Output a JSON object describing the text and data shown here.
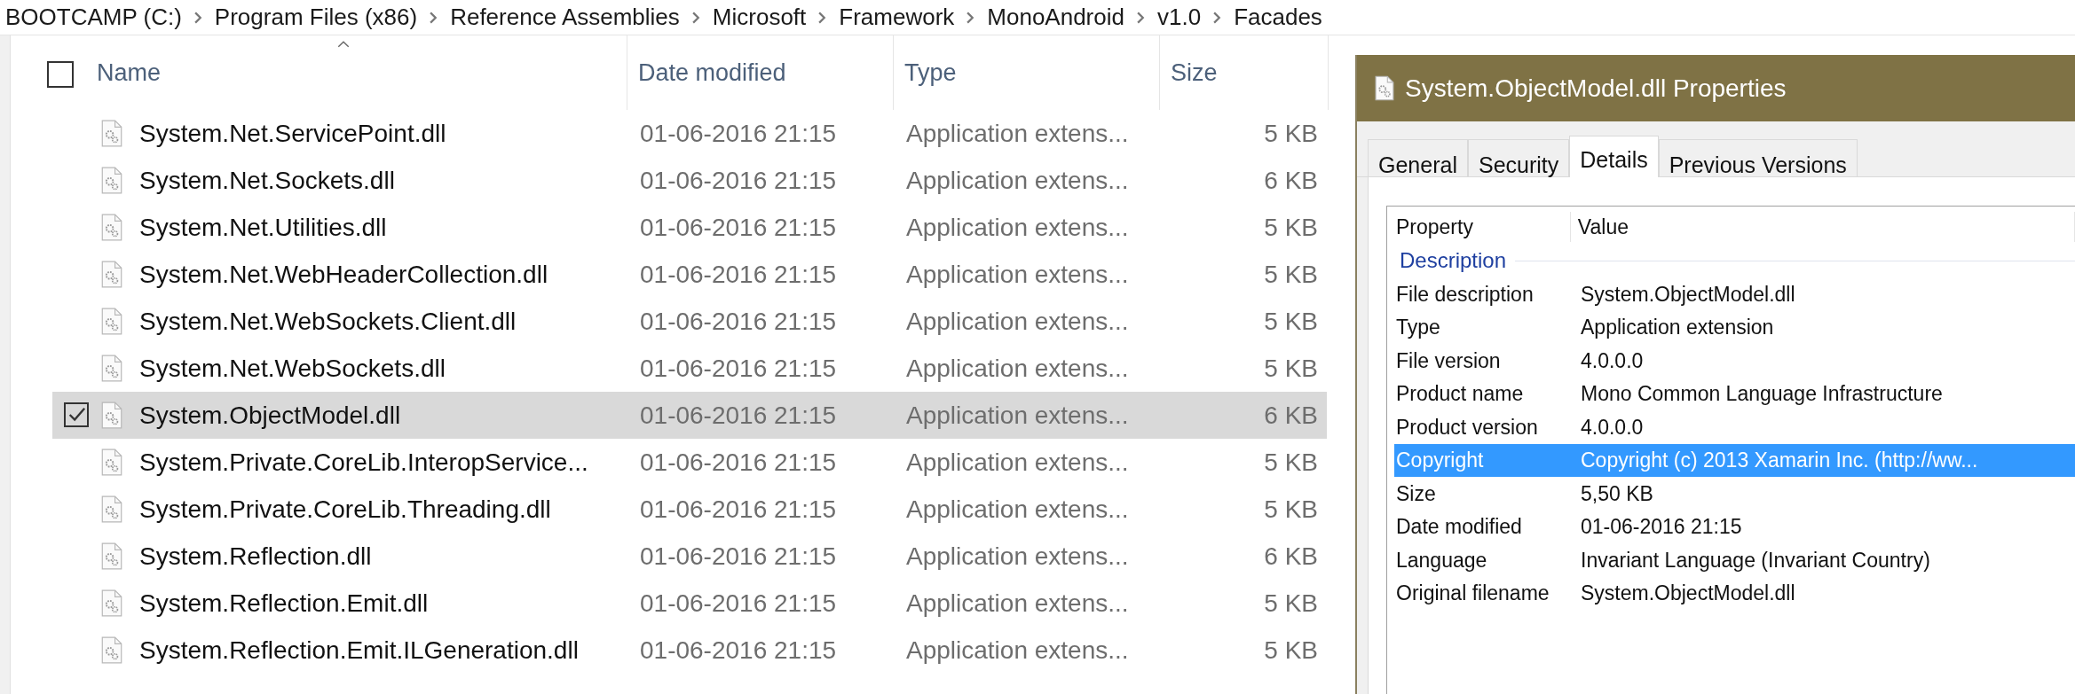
{
  "breadcrumb": [
    "BOOTCAMP (C:)",
    "Program Files (x86)",
    "Reference Assemblies",
    "Microsoft",
    "Framework",
    "MonoAndroid",
    "v1.0",
    "Facades"
  ],
  "file_list": {
    "select_all": {
      "checked": false
    },
    "columns": [
      {
        "label": "Name",
        "sorted": true
      },
      {
        "label": "Date modified",
        "sorted": false
      },
      {
        "label": "Type",
        "sorted": false
      },
      {
        "label": "Size",
        "sorted": false
      }
    ],
    "rows": [
      {
        "name": "System.Net.ServicePoint.dll",
        "date": "01-06-2016 21:15",
        "type": "Application extens...",
        "size": "5 KB",
        "selected": false
      },
      {
        "name": "System.Net.Sockets.dll",
        "date": "01-06-2016 21:15",
        "type": "Application extens...",
        "size": "6 KB",
        "selected": false
      },
      {
        "name": "System.Net.Utilities.dll",
        "date": "01-06-2016 21:15",
        "type": "Application extens...",
        "size": "5 KB",
        "selected": false
      },
      {
        "name": "System.Net.WebHeaderCollection.dll",
        "date": "01-06-2016 21:15",
        "type": "Application extens...",
        "size": "5 KB",
        "selected": false
      },
      {
        "name": "System.Net.WebSockets.Client.dll",
        "date": "01-06-2016 21:15",
        "type": "Application extens...",
        "size": "5 KB",
        "selected": false
      },
      {
        "name": "System.Net.WebSockets.dll",
        "date": "01-06-2016 21:15",
        "type": "Application extens...",
        "size": "5 KB",
        "selected": false
      },
      {
        "name": "System.ObjectModel.dll",
        "date": "01-06-2016 21:15",
        "type": "Application extens...",
        "size": "6 KB",
        "selected": true
      },
      {
        "name": "System.Private.CoreLib.InteropService...",
        "date": "01-06-2016 21:15",
        "type": "Application extens...",
        "size": "5 KB",
        "selected": false
      },
      {
        "name": "System.Private.CoreLib.Threading.dll",
        "date": "01-06-2016 21:15",
        "type": "Application extens...",
        "size": "5 KB",
        "selected": false
      },
      {
        "name": "System.Reflection.dll",
        "date": "01-06-2016 21:15",
        "type": "Application extens...",
        "size": "6 KB",
        "selected": false
      },
      {
        "name": "System.Reflection.Emit.dll",
        "date": "01-06-2016 21:15",
        "type": "Application extens...",
        "size": "5 KB",
        "selected": false
      },
      {
        "name": "System.Reflection.Emit.ILGeneration.dll",
        "date": "01-06-2016 21:15",
        "type": "Application extens...",
        "size": "5 KB",
        "selected": false
      }
    ]
  },
  "properties_window": {
    "title": "System.ObjectModel.dll Properties",
    "tabs": [
      {
        "label": "General",
        "selected": false
      },
      {
        "label": "Security",
        "selected": false
      },
      {
        "label": "Details",
        "selected": true
      },
      {
        "label": "Previous Versions",
        "selected": false
      }
    ],
    "columns": [
      "Property",
      "Value"
    ],
    "section": "Description",
    "rows": [
      {
        "property": "File description",
        "value": "System.ObjectModel.dll",
        "selected": false
      },
      {
        "property": "Type",
        "value": "Application extension",
        "selected": false
      },
      {
        "property": "File version",
        "value": "4.0.0.0",
        "selected": false
      },
      {
        "property": "Product name",
        "value": "Mono Common Language Infrastructure",
        "selected": false
      },
      {
        "property": "Product version",
        "value": "4.0.0.0",
        "selected": false
      },
      {
        "property": "Copyright",
        "value": "Copyright (c) 2013 Xamarin Inc. (http://ww...",
        "selected": true
      },
      {
        "property": "Size",
        "value": "5,50 KB",
        "selected": false
      },
      {
        "property": "Date modified",
        "value": "01-06-2016 21:15",
        "selected": false
      },
      {
        "property": "Language",
        "value": "Invariant Language (Invariant Country)",
        "selected": false
      },
      {
        "property": "Original filename",
        "value": "System.ObjectModel.dll",
        "selected": false
      }
    ]
  }
}
